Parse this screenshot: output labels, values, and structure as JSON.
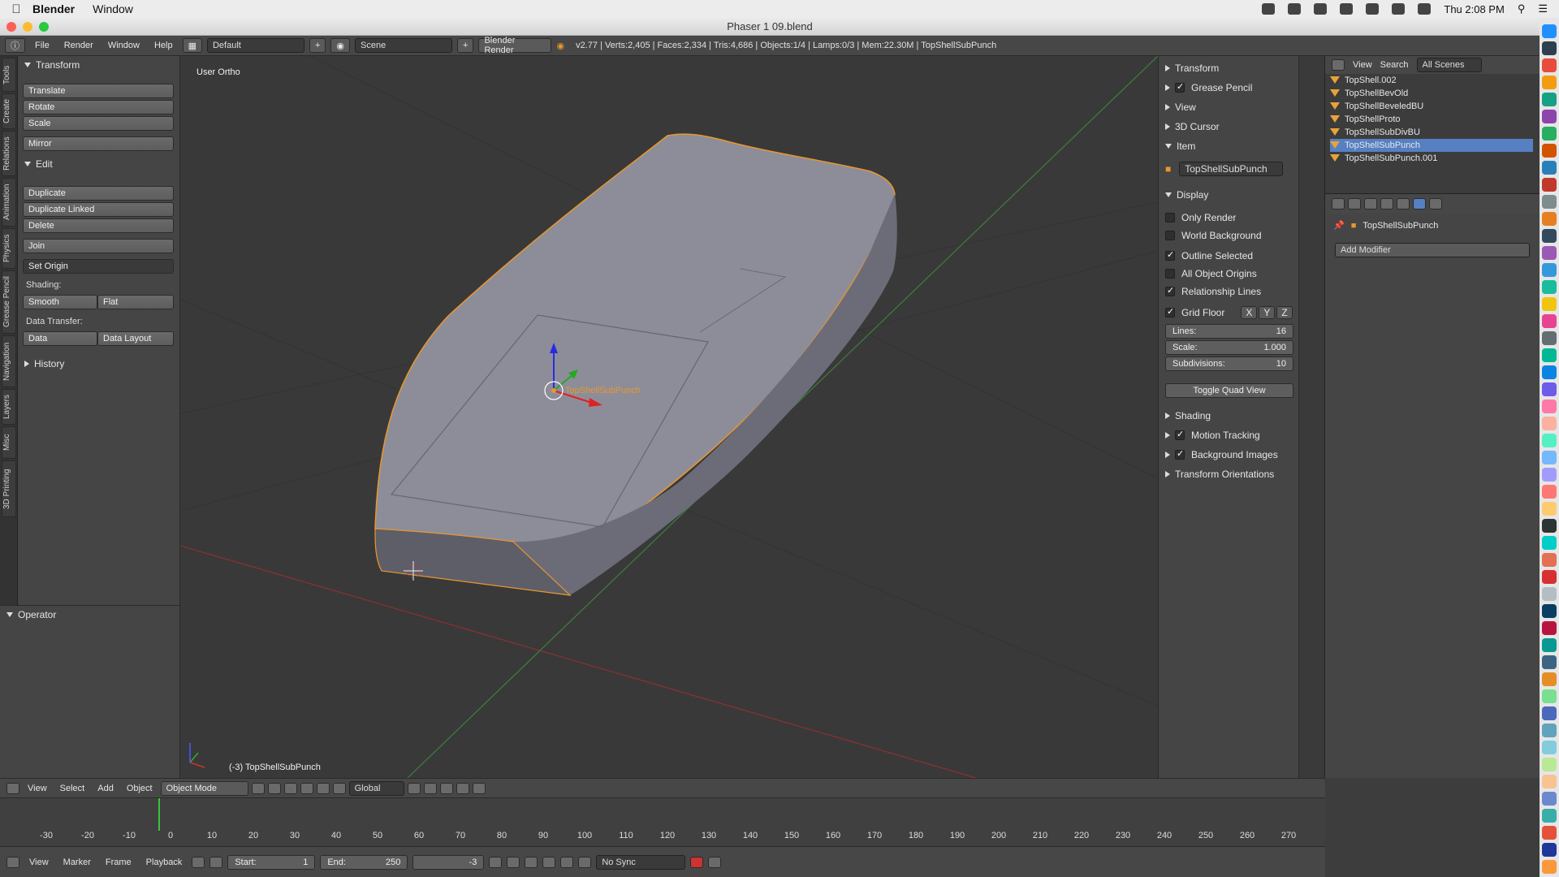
{
  "menubar": {
    "app": "Blender",
    "menu": [
      "Window"
    ],
    "clock": "Thu 2:08 PM"
  },
  "window": {
    "title": "Phaser 1 09.blend"
  },
  "info_header": {
    "menus": [
      "File",
      "Render",
      "Window",
      "Help"
    ],
    "layout": "Default",
    "scene": "Scene",
    "engine": "Blender Render",
    "stats": "v2.77 | Verts:2,405 | Faces:2,334 | Tris:4,686 | Objects:1/4 | Lamps:0/3 | Mem:22.30M | TopShellSubPunch"
  },
  "tool_tabs": [
    "Tools",
    "Create",
    "Relations",
    "Animation",
    "Physics",
    "Grease Pencil",
    "Navigation",
    "Layers",
    "Misc",
    "3D Printing"
  ],
  "tool_shelf": {
    "transform_title": "Transform",
    "translate": "Translate",
    "rotate": "Rotate",
    "scale": "Scale",
    "mirror": "Mirror",
    "edit_title": "Edit",
    "duplicate": "Duplicate",
    "duplicate_linked": "Duplicate Linked",
    "delete": "Delete",
    "join": "Join",
    "set_origin": "Set Origin",
    "shading_label": "Shading:",
    "smooth": "Smooth",
    "flat": "Flat",
    "data_transfer_label": "Data Transfer:",
    "data": "Data",
    "data_layout": "Data Layout",
    "history_title": "History",
    "operator_title": "Operator"
  },
  "viewport": {
    "view_label": "User Ortho",
    "object_label": "TopShellSubPunch",
    "footer_label": "(-3) TopShellSubPunch"
  },
  "n_panel": {
    "transform": "Transform",
    "grease_pencil": "Grease Pencil",
    "view": "View",
    "cursor": "3D Cursor",
    "item": "Item",
    "item_name": "TopShellSubPunch",
    "display": "Display",
    "only_render": "Only Render",
    "world_background": "World Background",
    "outline_selected": "Outline Selected",
    "all_object_origins": "All Object Origins",
    "relationship_lines": "Relationship Lines",
    "grid_floor": "Grid Floor",
    "axis_x": "X",
    "axis_y": "Y",
    "axis_z": "Z",
    "lines_label": "Lines:",
    "lines_value": "16",
    "scale_label": "Scale:",
    "scale_value": "1.000",
    "subdiv_label": "Subdivisions:",
    "subdiv_value": "10",
    "toggle_quad": "Toggle Quad View",
    "shading": "Shading",
    "motion_tracking": "Motion Tracking",
    "background_images": "Background Images",
    "transform_orientations": "Transform Orientations"
  },
  "outliner": {
    "view": "View",
    "search": "Search",
    "filter": "All Scenes",
    "items": [
      "TopShell.002",
      "TopShellBevOld",
      "TopShellBeveledBU",
      "TopShellProto",
      "TopShellSubDivBU",
      "TopShellSubPunch",
      "TopShellSubPunch.001"
    ],
    "selected_index": 5
  },
  "properties": {
    "object_name": "TopShellSubPunch",
    "add_modifier": "Add Modifier"
  },
  "viewport_header": {
    "menus": [
      "View",
      "Select",
      "Add",
      "Object"
    ],
    "mode": "Object Mode",
    "orientation": "Global"
  },
  "timeline": {
    "ticks": [
      -30,
      -20,
      -10,
      0,
      10,
      20,
      30,
      40,
      50,
      60,
      70,
      80,
      90,
      100,
      110,
      120,
      130,
      140,
      150,
      160,
      170,
      180,
      190,
      200,
      210,
      220,
      230,
      240,
      250,
      260,
      270
    ],
    "current_frame": -3
  },
  "timeline_header": {
    "menus": [
      "View",
      "Marker",
      "Frame",
      "Playback"
    ],
    "start_label": "Start:",
    "start_value": "1",
    "end_label": "End:",
    "end_value": "250",
    "current_value": "-3",
    "sync": "No Sync"
  },
  "colors": {
    "selection_outline": "#e8972e",
    "x_axis": "#c33",
    "y_axis": "#3a3",
    "z_axis": "#22d",
    "mesh": "#80808f"
  }
}
